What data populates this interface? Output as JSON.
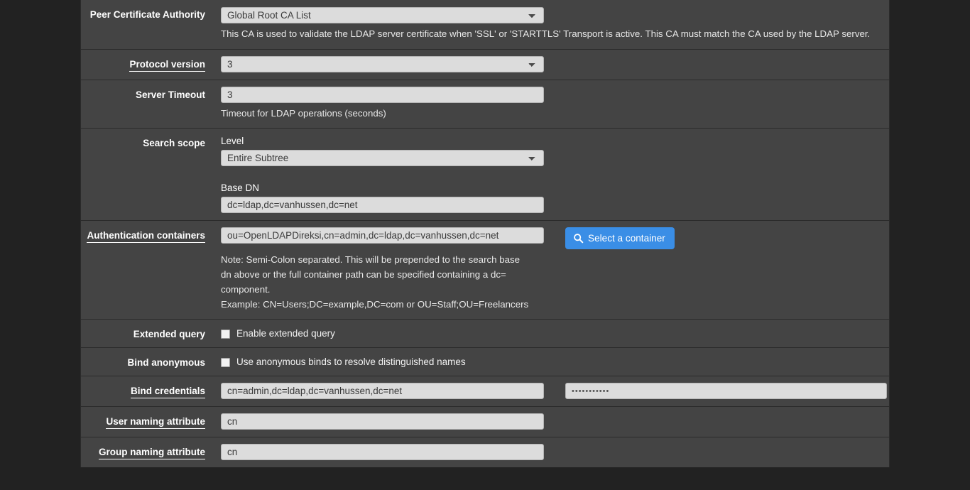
{
  "theme": {
    "page_bg": "#222222",
    "panel_bg": "#444444",
    "divider": "#2b2b2b",
    "input_bg": "#dcdcdc",
    "accent_blue": "#3a8ee6",
    "text": "#ffffff"
  },
  "form": {
    "rows": [
      {
        "label": "Peer Certificate Authority",
        "linked": false,
        "control_type": "select",
        "value": "Global Root CA List",
        "description": "This CA is used to validate the LDAP server certificate when 'SSL' or 'STARTTLS' Transport is active. This CA must match the CA used by the LDAP server."
      },
      {
        "label": "Protocol version",
        "linked": true,
        "control_type": "select",
        "value": "3",
        "description": ""
      },
      {
        "label": "Server Timeout",
        "linked": false,
        "control_type": "text",
        "value": "3",
        "description": "Timeout for LDAP operations (seconds)"
      },
      {
        "label": "Search scope",
        "linked": false,
        "control_type": "scope",
        "level_label": "Level",
        "level_value": "Entire Subtree",
        "basedn_label": "Base DN",
        "basedn_value": "dc=ldap,dc=vanhussen,dc=net"
      },
      {
        "label": "Authentication containers",
        "linked": true,
        "control_type": "container",
        "value": "ou=OpenLDAPDireksi,cn=admin,dc=ldap,dc=vanhussen,dc=net",
        "button_label": "Select a container",
        "button_icon": "search-icon",
        "description_lines": [
          "Note: Semi-Colon separated. This will be prepended to the search base",
          "dn above or the full container path can be specified containing a dc=",
          "component.",
          "Example: CN=Users;DC=example,DC=com or OU=Staff;OU=Freelancers"
        ]
      },
      {
        "label": "Extended query",
        "linked": false,
        "control_type": "checkbox",
        "checkbox_label": "Enable extended query",
        "checked": false
      },
      {
        "label": "Bind anonymous",
        "linked": false,
        "control_type": "checkbox",
        "checkbox_label": "Use anonymous binds to resolve distinguished names",
        "checked": false
      },
      {
        "label": "Bind credentials",
        "linked": true,
        "control_type": "credentials",
        "user_value": "cn=admin,dc=ldap,dc=vanhussen,dc=net",
        "password_value": "•••••••••••"
      },
      {
        "label": "User naming attribute",
        "linked": true,
        "control_type": "text",
        "value": "cn",
        "description": ""
      },
      {
        "label": "Group naming attribute",
        "linked": true,
        "control_type": "text",
        "value": "cn",
        "description": ""
      }
    ]
  }
}
